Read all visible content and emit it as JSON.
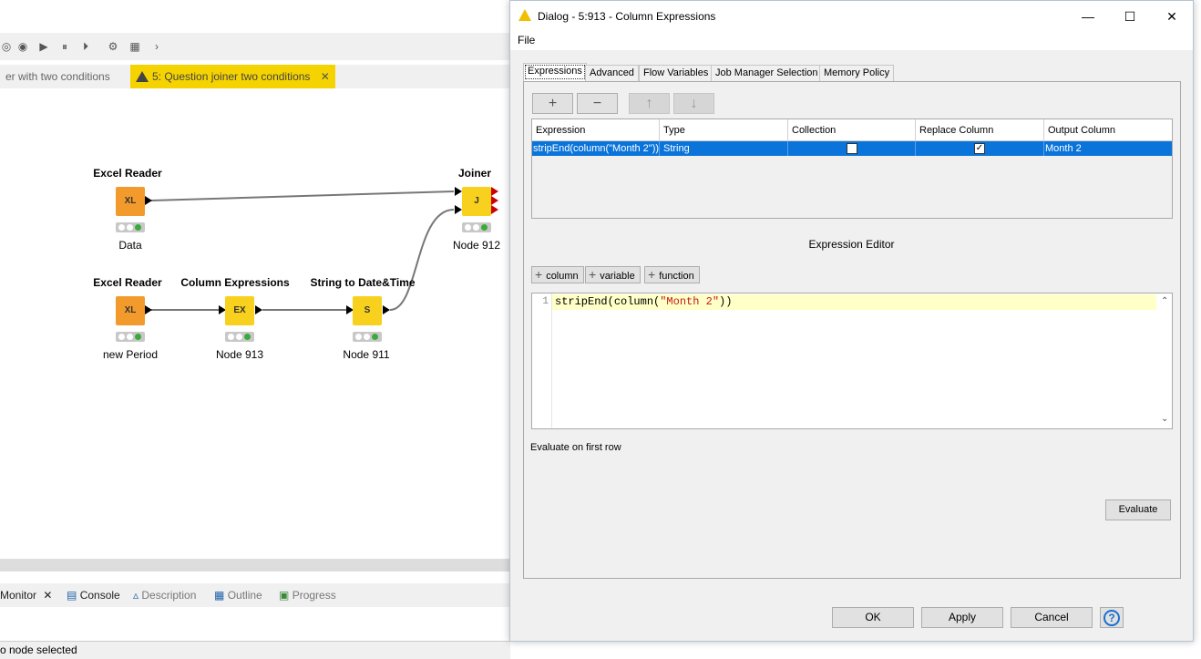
{
  "workspace": {
    "tabs": [
      {
        "label": "er with two conditions"
      },
      {
        "label": "5: Question joiner two conditions",
        "close": "✕"
      }
    ],
    "nodes": [
      {
        "title": "Excel Reader",
        "name": "Data",
        "icon": "XL"
      },
      {
        "title": "Excel Reader",
        "name": "new Period",
        "icon": "XL"
      },
      {
        "title": "Column Expressions",
        "name": "Node 913",
        "icon": "EX"
      },
      {
        "title": "String to Date&Time",
        "name": "Node 911",
        "icon": "S"
      },
      {
        "title": "Joiner",
        "name": "Node 912",
        "icon": "J"
      }
    ],
    "bottom_tabs": [
      {
        "label": "Monitor",
        "close": "✕"
      },
      {
        "label": "Console"
      },
      {
        "label": "Description"
      },
      {
        "label": "Outline"
      },
      {
        "label": "Progress"
      }
    ],
    "status": "o node selected"
  },
  "dialog": {
    "title": "Dialog - 5:913 - Column Expressions",
    "menu": [
      "File"
    ],
    "tabs": [
      "Expressions",
      "Advanced",
      "Flow Variables",
      "Job Manager Selection",
      "Memory Policy"
    ],
    "table": {
      "columns": [
        "Expression",
        "Type",
        "Collection",
        "Replace Column",
        "Output Column"
      ],
      "rows": [
        {
          "expression": "stripEnd(column(\"Month 2\"))",
          "type": "String",
          "collection": false,
          "replace_column": true,
          "output_column": "Month 2"
        }
      ]
    },
    "editor": {
      "title": "Expression Editor",
      "buttons": [
        "column",
        "variable",
        "function"
      ],
      "line_number": "1",
      "code_func": "stripEnd(",
      "code_arg": "column(",
      "code_str": "\"Month 2\"",
      "code_close": "))"
    },
    "evaluate_label": "Evaluate on first row",
    "evaluate_button": "Evaluate",
    "footer_buttons": {
      "ok": "OK",
      "apply": "Apply",
      "cancel": "Cancel",
      "help": "?"
    }
  }
}
